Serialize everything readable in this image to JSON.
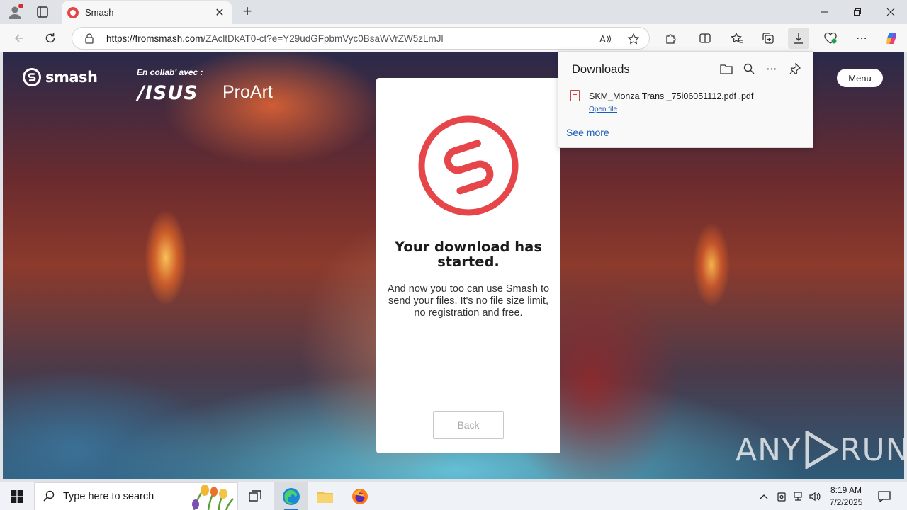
{
  "browser": {
    "tab_title": "Smash",
    "url_host": "https://fromsmash.com",
    "url_path": "/ZAcltDkAT0-ct?e=Y29udGFpbmVyc0BsaWVrZW5zLmJl"
  },
  "page": {
    "brand_name": "smash",
    "collab_label": "En collab' avec :",
    "partner_brand": "/ISUS",
    "partner_line": "ProArt",
    "menu_label": "Menu",
    "card": {
      "heading": "Your download has started.",
      "text_before_link": "And now you too can ",
      "link_text": "use Smash",
      "text_after_link": " to send your files. It's no file size limit, no registration and free.",
      "back_label": "Back"
    },
    "watermark_left": "ANY",
    "watermark_right": "RUN"
  },
  "downloads": {
    "title": "Downloads",
    "items": [
      {
        "file_name": "SKM_Monza Trans _75i06051112.pdf .pdf",
        "action": "Open file"
      }
    ],
    "see_more": "See more"
  },
  "taskbar": {
    "search_placeholder": "Type here to search",
    "time": "8:19 AM",
    "date": "7/2/2025"
  },
  "colors": {
    "smash_red": "#e6454a",
    "link_blue": "#1a5fb4",
    "taskbar_bg": "#eff3f7"
  }
}
